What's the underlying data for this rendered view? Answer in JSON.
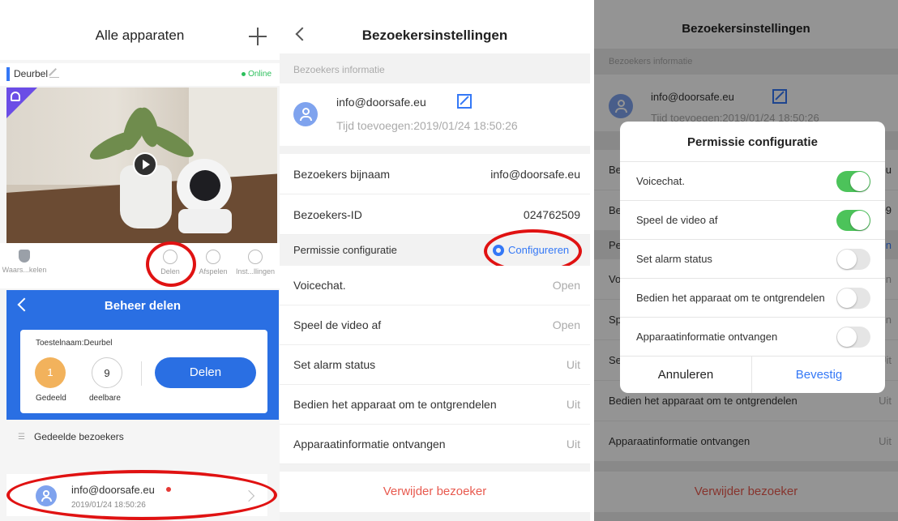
{
  "panel1": {
    "title": "Alle apparaten",
    "device_name": "Deurbel",
    "status": "Online",
    "actions": [
      {
        "label": "Waars...kelen",
        "icon": "shield-icon"
      },
      {
        "label": "Delen",
        "icon": "share-icon"
      },
      {
        "label": "Afspelen",
        "icon": "playback-icon"
      },
      {
        "label": "Inst...llingen",
        "icon": "settings-icon"
      }
    ],
    "share_title": "Beheer delen",
    "device_label": "Toestelnaam:Deurbel",
    "shared_count": "1",
    "shared_label": "Gedeeld",
    "shareable_count": "9",
    "shareable_label": "deelbare",
    "share_button": "Delen",
    "visitors_header": "Gedeelde bezoekers",
    "visitor_email": "info@doorsafe.eu",
    "visitor_date": "2019/01/24 18:50:26",
    "accent_color": "#2a6fe3"
  },
  "panel2": {
    "title": "Bezoekersinstellingen",
    "section_label": "Bezoekers informatie",
    "email": "info@doorsafe.eu",
    "time_added": "Tijd toevoegen:2019/01/24 18:50:26",
    "nickname_label": "Bezoekers bijnaam",
    "nickname_value": "info@doorsafe.eu",
    "id_label": "Bezoekers-ID",
    "id_value": "024762509",
    "perm_label": "Permissie configuratie",
    "configure": "Configureren",
    "permissions": [
      {
        "label": "Voicechat.",
        "value": "Open"
      },
      {
        "label": "Speel de video af",
        "value": "Open"
      },
      {
        "label": "Set alarm status",
        "value": "Uit"
      },
      {
        "label": "Bedien het apparaat om te ontgrendelen",
        "value": "Uit"
      },
      {
        "label": "Apparaatinformatie ontvangen",
        "value": "Uit"
      }
    ],
    "delete": "Verwijder bezoeker"
  },
  "panel3": {
    "title": "Bezoekersinstellingen",
    "section_label": "Bezoekers informatie",
    "email": "info@doorsafe.eu",
    "time_added": "Tijd toevoegen:2019/01/24 18:50:26",
    "bg_rows": [
      {
        "label": "Be",
        "value": "eu"
      },
      {
        "label": "Be",
        "value": "09"
      },
      {
        "label": "Pe",
        "value": "en"
      },
      {
        "label": "Vo",
        "value": "en"
      },
      {
        "label": "Sp",
        "value": "en"
      },
      {
        "label": "Se",
        "value": "Uit"
      },
      {
        "label": "Bedien het apparaat om te ontgrendelen",
        "value": "Uit"
      },
      {
        "label": "Apparaatinformatie ontvangen",
        "value": "Uit"
      }
    ],
    "delete": "Verwijder bezoeker",
    "dialog": {
      "title": "Permissie configuratie",
      "items": [
        {
          "label": "Voicechat.",
          "on": true
        },
        {
          "label": "Speel de video af",
          "on": true
        },
        {
          "label": "Set alarm status",
          "on": false
        },
        {
          "label": "Bedien het apparaat om te ontgrendelen",
          "on": false
        },
        {
          "label": "Apparaatinformatie ontvangen",
          "on": false
        }
      ],
      "cancel": "Annuleren",
      "confirm": "Bevestig"
    }
  }
}
